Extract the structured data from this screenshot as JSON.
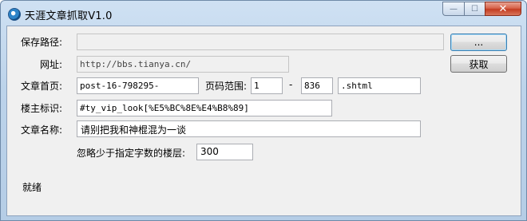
{
  "window": {
    "title": "天涯文章抓取V1.0",
    "min_glyph": "—",
    "max_glyph": "☐",
    "close_glyph": "✕"
  },
  "form": {
    "save_path": {
      "label": "保存路径:",
      "value": "",
      "button": "..."
    },
    "url": {
      "label": "网址:",
      "value": "http://bbs.tianya.cn/",
      "button": "获取"
    },
    "article_home": {
      "label": "文章首页:",
      "value": "post-16-798295-"
    },
    "page_range": {
      "label": "页码范围:",
      "from": "1",
      "separator": "-",
      "to": "836",
      "ext": ".shtml"
    },
    "author_id": {
      "label": "楼主标识:",
      "value": "#ty_vip_look[%E5%BC%8E%E4%B8%89]"
    },
    "article_name": {
      "label": "文章名称:",
      "value": "请别把我和神棍混为一谈"
    },
    "min_chars": {
      "label": "忽略少于指定字数的楼层:",
      "value": "300"
    }
  },
  "status": {
    "text": "就绪"
  }
}
